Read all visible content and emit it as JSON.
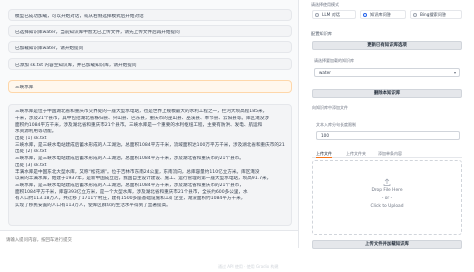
{
  "chat": {
    "messages": [
      {
        "role": "bot",
        "text": "模型已成功加载，可以开始对话，或从右侧选择模式后开始对话"
      },
      {
        "role": "bot",
        "text": "已选择知识库water，当前知识库中暂无已上传文件，请先上传文件后再开始提问"
      },
      {
        "role": "bot",
        "text": "已加载知识库water，请开始提问"
      },
      {
        "role": "bot",
        "text": "已添加 sk.txt 内容至知识库，并已加载知识库，请开始提问"
      },
      {
        "role": "user",
        "text": "三峡水库"
      },
      {
        "role": "bot",
        "lines": [
          "三峡水库是位于中国湖北省和重庆市交界处的一座大型水电站，也是世界上规模最大的水利工程之一，拦河大坝高程185米，",
          "千米，涉及21个县市，其中包括湖北省秭归县、兴山县、巴东县，重庆市的巫山县、巫溪县、奉节县、云阳县等。库区淹没涉",
          "面积约1084平方千米，涉及湖北省和重庆市21个县市。三峡水库是一个重要的水利枢纽工程，主要有防洪、发电、航运和",
          "水资源利用等功能。",
          "出处 [1] sk.txt",
          "三峡水库，是三峡水电站建成后蓄水形成的人工湖泊，总面积1084平方千米，流域面积达100万平方千米，涉及湖北省和重庆市的21个县市。",
          "出处 [2] sk.txt",
          "三峡水库，是三峡水电站建成后蓄水形成的人工湖泊，总面积1084平方千米，涉及湖北省和重庆市的21个县市。",
          "出处 [3] sk.txt",
          "丰满水库是中国东北大型水库，又称“松花湖”。位于吉林市东南24公里，东南流向，总库容量约110亿立方米。库区淹没",
          "以来的丰满水库，始建于1937年，是新中国成立后，我国自主设计建设、施工、运行管理的第一座大型水电站，坝高91.7米，",
          "三峡水库，是三峡水电站建成后蓄水形成的人工湖泊，总面积1084平方千米，涉及湖北省和重庆市的21个县市，",
          "面积1084平方千米，库容393亿立方米，是一个大型水库，涉及湖北省和重庆市21个县市，全长约600多公里，水",
          "有人口约113.18万人，共迁移了1711个村庄，建有1500多座基础设施和工矿企业，淹没面积约1084平方千米，",
          "实现了移民安置的人口有113万人，使库区群众的生活水平得到了显著提高。"
        ]
      }
    ],
    "input_placeholder": "请输入提问内容，按回车进行提交",
    "footer": "通过 API 使用 · 使用 Gradio 构建"
  },
  "settings": {
    "mode_label": "请选择使用模式",
    "modes": [
      {
        "label": "LLM 对话",
        "selected": false
      },
      {
        "label": "知识库问答",
        "selected": true
      },
      {
        "label": "Bing搜索问答",
        "selected": false
      }
    ],
    "kb_section_title": "配置知识库",
    "refresh_button": "更新已有知识库选项",
    "select_kb_label": "请选择要加载的知识库",
    "selected_kb": "water",
    "delete_button": "删除本知识库",
    "add_file_section": "向知识库中添加文件",
    "chunk_label": "文本入库分句长度限制",
    "chunk_value": "100",
    "tabs": [
      {
        "label": "上传文件",
        "active": true
      },
      {
        "label": "上传文件夹",
        "active": false
      },
      {
        "label": "添加单条内容",
        "active": false
      }
    ],
    "drop_text_1": "Drop File Here",
    "drop_text_2": "- or -",
    "drop_text_3": "Click to Upload",
    "upload_button": "上传文件并加载知识库"
  }
}
